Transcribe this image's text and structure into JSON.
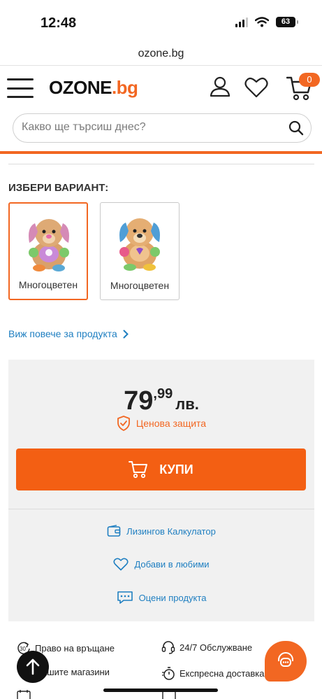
{
  "status": {
    "time": "12:48",
    "battery": "63"
  },
  "browser": {
    "url": "ozone.bg"
  },
  "header": {
    "logo_main": "OZONE",
    "logo_suffix": ".bg",
    "cart_count": "0"
  },
  "search": {
    "placeholder": "Какво ще търсиш днес?"
  },
  "variants": {
    "title": "ИЗБЕРИ ВАРИАНТ:",
    "items": [
      {
        "label": "Многоцветен",
        "selected": true,
        "accent": "#e879b4"
      },
      {
        "label": "Многоцветен",
        "selected": false,
        "accent": "#5aa9d6"
      }
    ]
  },
  "more_link": "Виж повече за продукта",
  "price": {
    "integer": "79",
    "decimal": ",99",
    "currency": "лв.",
    "protection": "Ценова защита"
  },
  "buy_button": "КУПИ",
  "actions": {
    "leasing": "Лизингов Калкулатор",
    "favorite": "Добави в любими",
    "rate": "Оцени продукта"
  },
  "features": [
    {
      "label": "Право на връщане",
      "icon": "return-30-icon"
    },
    {
      "label": "24/7 Обслужване",
      "icon": "headset-icon"
    },
    {
      "label": "ашите магазини",
      "icon": "store-icon"
    },
    {
      "label": "Експресна доставка",
      "icon": "stopwatch-icon"
    }
  ],
  "colors": {
    "brand": "#f26722",
    "link": "#1f7fc1",
    "panel": "#f1f1f1"
  }
}
